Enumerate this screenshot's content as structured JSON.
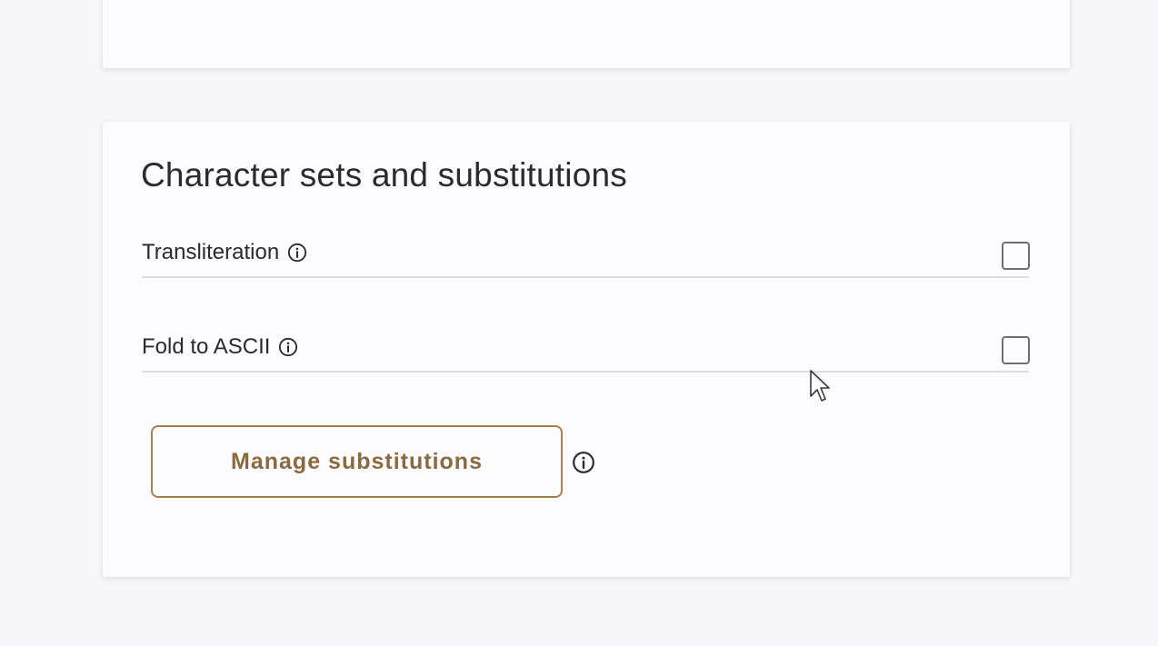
{
  "section": {
    "title": "Character sets and substitutions"
  },
  "options": [
    {
      "label": "Transliteration",
      "checked": false,
      "icon": "info-icon"
    },
    {
      "label": "Fold to ASCII",
      "checked": false,
      "icon": "info-icon"
    }
  ],
  "manage_button": {
    "label": "Manage substitutions",
    "icon": "info-icon"
  },
  "colors": {
    "accent": "#a8814a",
    "accent_text": "#8a6a3f",
    "background": "#f7f6f8",
    "card": "#fcfbfd",
    "text": "#2b2a2e",
    "divider": "#dedde1"
  },
  "cursor_icon": "mouse-pointer-icon"
}
